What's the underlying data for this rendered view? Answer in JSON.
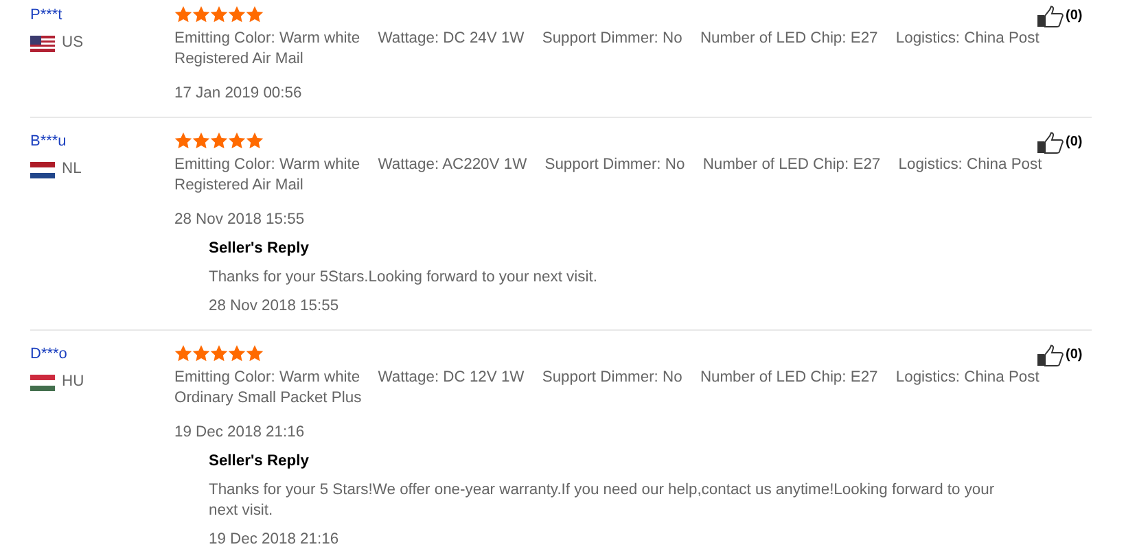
{
  "reviews": [
    {
      "name": "P***t",
      "flag": {
        "kind": "us"
      },
      "country": "US",
      "stars": 5,
      "attributes": [
        "Emitting Color: Warm white",
        "Wattage: DC 24V 1W",
        "Support Dimmer: No",
        "Number of LED Chip: E27",
        "Logistics: China Post Registered Air Mail"
      ],
      "date": "17 Jan 2019 00:56",
      "likes": "(0)"
    },
    {
      "name": "B***u",
      "flag": {
        "kind": "nl"
      },
      "country": "NL",
      "stars": 5,
      "attributes": [
        "Emitting Color: Warm white",
        "Wattage: AC220V 1W",
        "Support Dimmer: No",
        "Number of LED Chip: E27",
        "Logistics: China Post Registered Air Mail"
      ],
      "date": "28 Nov 2018 15:55",
      "likes": "(0)",
      "reply": {
        "title": "Seller's Reply",
        "text": "Thanks for your 5Stars.Looking forward to your next visit.",
        "date": "28 Nov 2018 15:55"
      }
    },
    {
      "name": "D***o",
      "flag": {
        "kind": "hu"
      },
      "country": "HU",
      "stars": 5,
      "attributes": [
        "Emitting Color: Warm white",
        "Wattage: DC 12V 1W",
        "Support Dimmer: No",
        "Number of LED Chip: E27",
        "Logistics: China Post Ordinary Small Packet Plus"
      ],
      "date": "19 Dec 2018 21:16",
      "likes": "(0)",
      "reply": {
        "title": "Seller's Reply",
        "text": "Thanks for your 5 Stars!We offer one-year warranty.If you need our help,contact us anytime!Looking forward to your next visit.",
        "date": "19 Dec 2018 21:16"
      }
    }
  ]
}
